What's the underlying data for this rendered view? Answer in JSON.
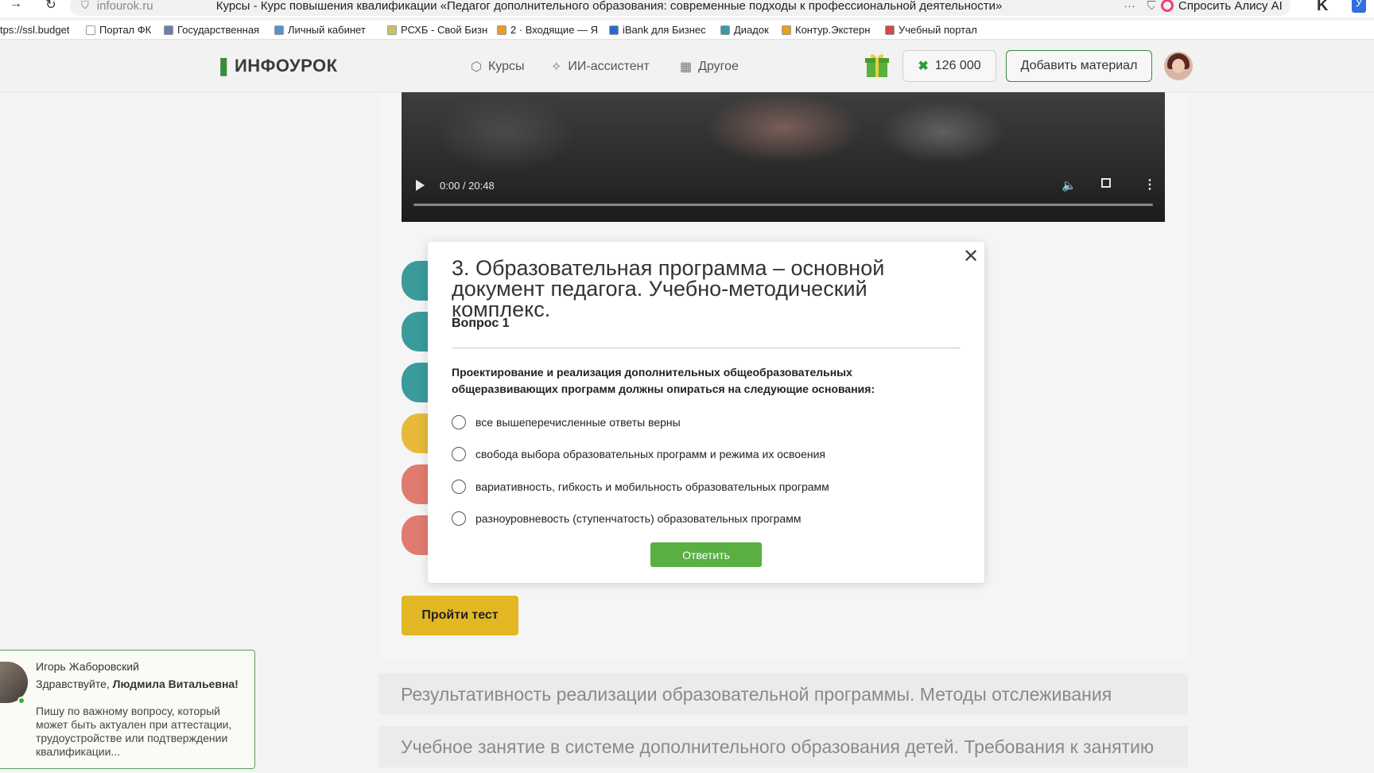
{
  "browser": {
    "url": "infourok.ru",
    "tab_title": "Курсы - Курс повышения квалификации «Педагог дополнительного образования: современные подходы к профессиональной деятельности»",
    "more": "···",
    "alice_label": "Спросить Алису AI",
    "bookmarks": [
      {
        "label": "tps://ssl.budget",
        "color": "#ffffff"
      },
      {
        "label": "Портал ФК",
        "color": "#ffffff"
      },
      {
        "label": "Государственная",
        "color": "#6a7fb0"
      },
      {
        "label": "Личный кабинет",
        "color": "#5a8fd0"
      },
      {
        "label": "РСХБ - Свой Бизн",
        "color": "#c8c26a"
      },
      {
        "label": "2 · Входящие — Я",
        "color": "#e89a2a"
      },
      {
        "label": "iBank для Бизнес",
        "color": "#2a6ad0"
      },
      {
        "label": "Диадок",
        "color": "#3a9aa0"
      },
      {
        "label": "Контур.Экстерн",
        "color": "#e8a020"
      },
      {
        "label": "Учебный портал",
        "color": "#d04a4a"
      }
    ]
  },
  "header": {
    "logo": "ИНФОУРОК",
    "nav": [
      {
        "label": "Курсы",
        "icon": "cube-icon"
      },
      {
        "label": "ИИ-ассистент",
        "icon": "sparkle-icon"
      },
      {
        "label": "Другое",
        "icon": "grid-icon"
      }
    ],
    "coins": "126 000",
    "add_material": "Добавить материал"
  },
  "video": {
    "time": "0:00 / 20:48",
    "progress": 0
  },
  "page": {
    "take_test": "Пройти тест",
    "modules": [
      "Результативность реализации образовательной программы. Методы отслеживания",
      "Учебное занятие в системе дополнительного образования детей. Требования к занятию"
    ]
  },
  "chat": {
    "name": "Игорь Жаборовский",
    "greeting_prefix": "Здравствуйте, ",
    "greeting_name": "Людмила Витальевна!",
    "body": "Пишу по важному вопросу, который может быть актуален при аттестации, трудоустройстве или подтверждении квалификации..."
  },
  "modal": {
    "title": "3. Образовательная программа – основной документ педагога. Учебно-методический комплекс.",
    "question_number": "Вопрос 1",
    "question": "Проектирование и реализация дополнительных общеобразовательных общеразвивающих программ должны опираться на следующие основания:",
    "answers": [
      "все вышеперечисленные ответы верны",
      "свобода выбора образовательных программ и режима их освоения",
      "вариативность, гибкость и мобильность образовательных программ",
      "разноуровневость (ступенчатость) образовательных программ"
    ],
    "submit": "Ответить"
  },
  "colors": {
    "accent_green": "#5aaf42",
    "test_button": "#e2b723"
  }
}
